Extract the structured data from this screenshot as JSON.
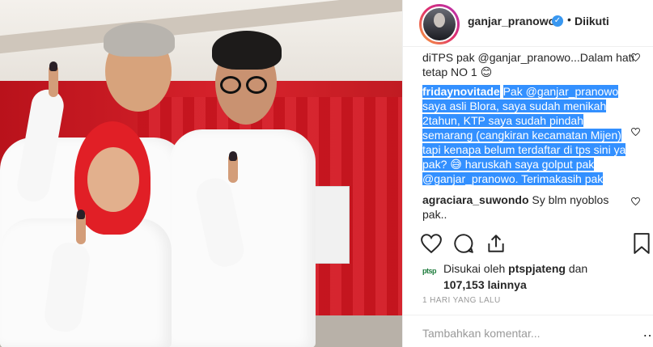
{
  "photo": {
    "description_icon": "photo"
  },
  "post": {
    "username": "ganjar_pranowo",
    "verified_icon": "verified-badge-icon",
    "dot": "•",
    "follow_label": "Diikuti"
  },
  "comments": [
    {
      "user": "",
      "text": "diTPS pak @ganjar_pranowo...Dalam hati tetap NO 1 😊"
    },
    {
      "user": "fridaynovitade",
      "text": "Pak @ganjar_pranowo saya asli Blora, saya sudah menikah 2tahun, KTP saya sudah pindah semarang (cangkiran kecamatan Mijen) tapi kenapa belum terdaftar di tps sini ya pak? 😅 haruskah saya golput pak @ganjar_pranowo. Terimakasih pak"
    },
    {
      "user": "agraciara_suwondo",
      "text": "Sy blm nyoblos pak.."
    }
  ],
  "actions": {
    "like_icon": "heart-icon",
    "comment_icon": "comment-icon",
    "share_icon": "share-icon",
    "save_icon": "bookmark-icon"
  },
  "likes": {
    "avatar_text": "ptsp",
    "prefix": "Disukai oleh ",
    "user": "ptspjateng",
    "middle": " dan",
    "count": "107,153 lainnya"
  },
  "time": "1 HARI YANG LALU",
  "add_comment": {
    "placeholder": "Tambahkan komentar...",
    "more": "…"
  },
  "colors": {
    "highlight": "#3390ff",
    "verified": "#3897f0",
    "accent_red": "#e11f26"
  }
}
